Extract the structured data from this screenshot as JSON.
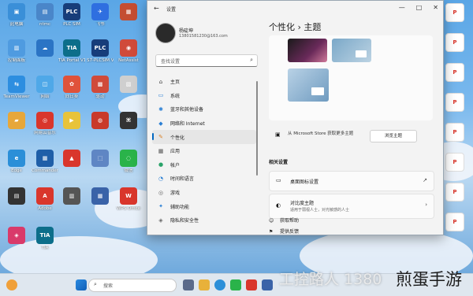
{
  "desktop": {
    "left_icons": [
      {
        "label": "此电脑",
        "color": "#3a8fd8",
        "glyph": "▣"
      },
      {
        "label": "ntmc",
        "color": "#4a86c9",
        "glyph": "▤"
      },
      {
        "label": "PLC SIM",
        "color": "#173d7a",
        "glyph": "PLC"
      },
      {
        "label": "飞书",
        "color": "#2f6fe0",
        "glyph": "✈"
      },
      {
        "label": "",
        "color": "#c44d32",
        "glyph": "▦"
      },
      {
        "label": "控制面板",
        "color": "#4f9be0",
        "glyph": "▥"
      },
      {
        "label": "",
        "color": "#2b74c5",
        "glyph": "☁"
      },
      {
        "label": "TIA Portal V16",
        "color": "#0c6e8a",
        "glyph": "TIA"
      },
      {
        "label": "S7-PLCSIM V16",
        "color": "#173d7a",
        "glyph": "PLC"
      },
      {
        "label": "NetAssist",
        "color": "#d04a3a",
        "glyph": "◉"
      },
      {
        "label": "TeamViewer",
        "color": "#2d8ee0",
        "glyph": "⇆"
      },
      {
        "label": "网络",
        "color": "#4fa8e8",
        "glyph": "◫"
      },
      {
        "label": "向日葵",
        "color": "#e0523a",
        "glyph": "✿"
      },
      {
        "label": "驱动",
        "color": "#d04a3a",
        "glyph": "▩"
      },
      {
        "label": "",
        "color": "#cfcfcf",
        "glyph": "▧"
      },
      {
        "label": "",
        "color": "#e7a73a",
        "glyph": "▰"
      },
      {
        "label": "网易云音乐",
        "color": "#d9362c",
        "glyph": "◎"
      },
      {
        "label": "",
        "color": "#e8c33a",
        "glyph": "▶"
      },
      {
        "label": "",
        "color": "#c93a2a",
        "glyph": "◍"
      },
      {
        "label": "",
        "color": "#333333",
        "glyph": "⌘"
      },
      {
        "label": "Edge",
        "color": "#2b8fd8",
        "glyph": "e"
      },
      {
        "label": "Commander",
        "color": "#1f5fa8",
        "glyph": "▦"
      },
      {
        "label": "",
        "color": "#d9362c",
        "glyph": "▲"
      },
      {
        "label": "",
        "color": "#5f86c4",
        "glyph": "⬚"
      },
      {
        "label": "微信",
        "color": "#2ab34a",
        "glyph": "◌"
      },
      {
        "label": "",
        "color": "#333333",
        "glyph": "▤"
      },
      {
        "label": "Adobe",
        "color": "#d9362c",
        "glyph": "A"
      },
      {
        "label": "",
        "color": "#555555",
        "glyph": "▥"
      },
      {
        "label": "",
        "color": "#3a63a8",
        "glyph": "▦"
      },
      {
        "label": "WPS Office",
        "color": "#d9362c",
        "glyph": "W"
      },
      {
        "label": "",
        "color": "#d93a6a",
        "glyph": "◈"
      },
      {
        "label": "TIA",
        "color": "#0c6e8a",
        "glyph": "TIA"
      }
    ],
    "right_icons": [
      {
        "label": "",
        "color": "#d9362c",
        "glyph": "P"
      },
      {
        "label": "",
        "color": "#d9362c",
        "glyph": "P"
      },
      {
        "label": "",
        "color": "#d9362c",
        "glyph": "P"
      },
      {
        "label": "",
        "color": "#d9362c",
        "glyph": "P"
      },
      {
        "label": "",
        "color": "#d9362c",
        "glyph": "P"
      },
      {
        "label": "",
        "color": "#d9362c",
        "glyph": "P"
      },
      {
        "label": "",
        "color": "#d9362c",
        "glyph": "P"
      },
      {
        "label": "",
        "color": "#d9362c",
        "glyph": "P"
      }
    ]
  },
  "window": {
    "title": "设置",
    "back_glyph": "←",
    "minimize_glyph": "—",
    "maximize_glyph": "□",
    "close_glyph": "✕",
    "user": {
      "name": "杨碇坤",
      "email": "13801581230@163.com"
    },
    "search_placeholder": "查找设置",
    "nav": [
      {
        "label": "主页",
        "icon": "⌂",
        "color": "#444444",
        "selected": false
      },
      {
        "label": "系统",
        "icon": "▭",
        "color": "#2a7fd4",
        "selected": false
      },
      {
        "label": "蓝牙和其他设备",
        "icon": "✱",
        "color": "#2a7fd4",
        "selected": false
      },
      {
        "label": "网络和 Internet",
        "icon": "◆",
        "color": "#2a7fd4",
        "selected": false
      },
      {
        "label": "个性化",
        "icon": "✎",
        "color": "#d9822b",
        "selected": true
      },
      {
        "label": "应用",
        "icon": "▦",
        "color": "#555555",
        "selected": false
      },
      {
        "label": "帐户",
        "icon": "●",
        "color": "#2aa36a",
        "selected": false
      },
      {
        "label": "时间和语言",
        "icon": "◔",
        "color": "#2a7fd4",
        "selected": false
      },
      {
        "label": "游戏",
        "icon": "◎",
        "color": "#666666",
        "selected": false
      },
      {
        "label": "辅助功能",
        "icon": "✦",
        "color": "#2a7fd4",
        "selected": false
      },
      {
        "label": "隐私和安全性",
        "icon": "◈",
        "color": "#666666",
        "selected": false
      }
    ],
    "breadcrumb": "个性化  ›  主题",
    "store_text": "从 Microsoft Store 获取更多主题",
    "store_button": "浏览主题",
    "related_title": "相关设置",
    "related": [
      {
        "title": "桌面图标设置",
        "subtitle": "",
        "icon": "▭",
        "arrow": "↗"
      },
      {
        "title": "对比度主题",
        "subtitle": "适用于弱视人士，对光敏感的人士",
        "icon": "◐",
        "arrow": "›"
      }
    ],
    "help_links": [
      {
        "label": "获取帮助",
        "icon": "☺"
      },
      {
        "label": "提供反馈",
        "icon": "⚑"
      }
    ]
  },
  "taskbar": {
    "search_placeholder": "搜索",
    "search_glyph": "⌕"
  },
  "watermark": {
    "text_light": "工控路人 1380",
    "text_dark": "煎蛋手游"
  }
}
